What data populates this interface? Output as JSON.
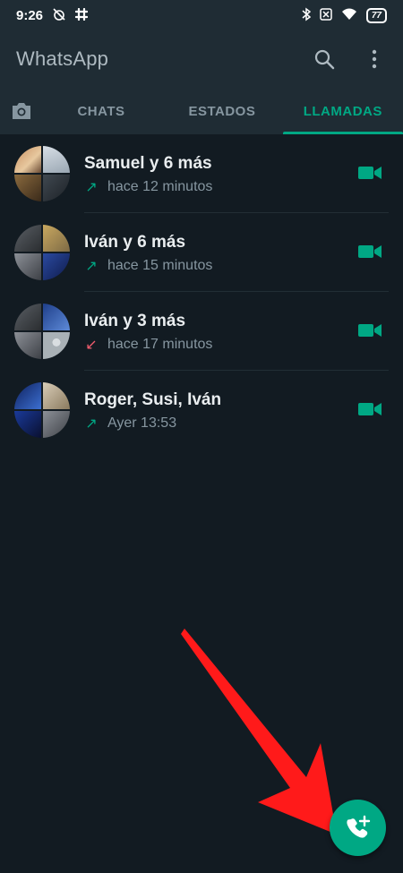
{
  "status_bar": {
    "time": "9:26",
    "battery": "77"
  },
  "app_bar": {
    "title": "WhatsApp"
  },
  "tabs": [
    {
      "label": "CHATS",
      "selected": false
    },
    {
      "label": "ESTADOS",
      "selected": false
    },
    {
      "label": "LLAMADAS",
      "selected": true
    }
  ],
  "calls": [
    {
      "name": "Samuel y 6 más",
      "time": "hace 12 minutos",
      "direction": "outgoing",
      "arrow": "↗",
      "type": "video"
    },
    {
      "name": "Iván y 6 más",
      "time": "hace 15 minutos",
      "direction": "outgoing",
      "arrow": "↗",
      "type": "video"
    },
    {
      "name": "Iván y 3 más",
      "time": "hace 17 minutos",
      "direction": "incoming",
      "arrow": "↙",
      "type": "video"
    },
    {
      "name": "Roger, Susi, Iván",
      "time": "Ayer 13:53",
      "direction": "outgoing",
      "arrow": "↗",
      "type": "video"
    }
  ],
  "colors": {
    "accent": "#00a884",
    "background": "#121b22",
    "header": "#1f2c34",
    "missed": "#f15c6d",
    "annotation_arrow": "#ff1a1a"
  },
  "icons": [
    "camera-icon",
    "search-icon",
    "more-vert-icon",
    "video-call-icon",
    "new-call-icon"
  ]
}
